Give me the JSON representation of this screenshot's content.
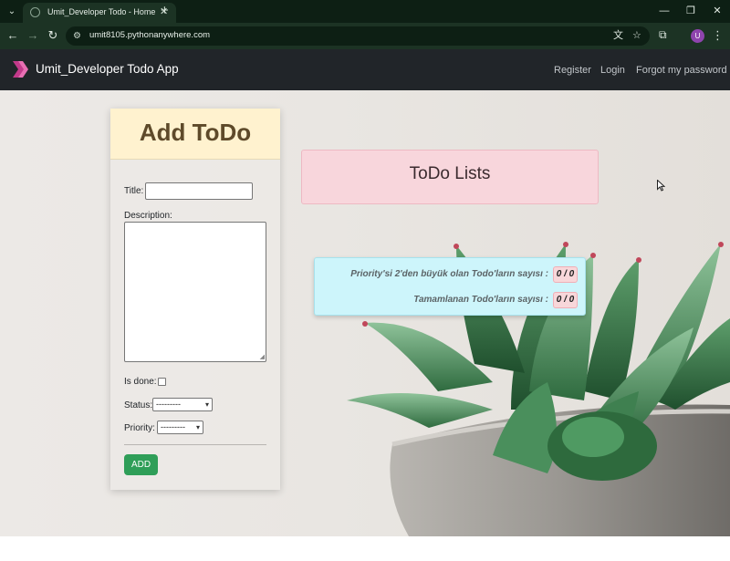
{
  "browser": {
    "tab_title": "Umit_Developer Todo - Home",
    "url": "umit8105.pythonanywhere.com",
    "profile_initial": "U",
    "icons": [
      "tab-search-icon",
      "favicon-icon",
      "close-icon",
      "new-tab-icon",
      "minimize-icon",
      "restore-icon",
      "window-close-icon",
      "back-icon",
      "forward-icon",
      "reload-icon",
      "site-info-icon",
      "translate-icon",
      "star-icon",
      "extensions-icon",
      "menu-icon"
    ]
  },
  "navbar": {
    "brand": "Umit_Developer Todo App",
    "links": {
      "register": "Register",
      "login": "Login",
      "forgot": "Forgot my password"
    }
  },
  "add_form": {
    "heading": "Add ToDo",
    "title_label": "Title:",
    "title_value": "",
    "description_label": "Description:",
    "description_value": "",
    "is_done_label": "Is done:",
    "is_done_checked": false,
    "status_label": "Status:",
    "status_selected": "---------",
    "priority_label": "Priority:",
    "priority_selected": "---------",
    "submit_label": "ADD"
  },
  "todo_list": {
    "heading": "ToDo Lists"
  },
  "stats": {
    "priority_label": "Priority'si 2'den büyük olan Todo'ların sayısı :",
    "priority_value": "0 / 0",
    "done_label": "Tamamlanan Todo'ların sayısı :",
    "done_value": "0 / 0"
  },
  "colors": {
    "navbar_bg": "#212529",
    "add_header_bg": "#fff2cf",
    "add_button_bg": "#2f9e58",
    "list_card_bg": "#f8d6dc",
    "stats_bg": "#cdf5fb",
    "badge_bg": "#f8d7da"
  }
}
